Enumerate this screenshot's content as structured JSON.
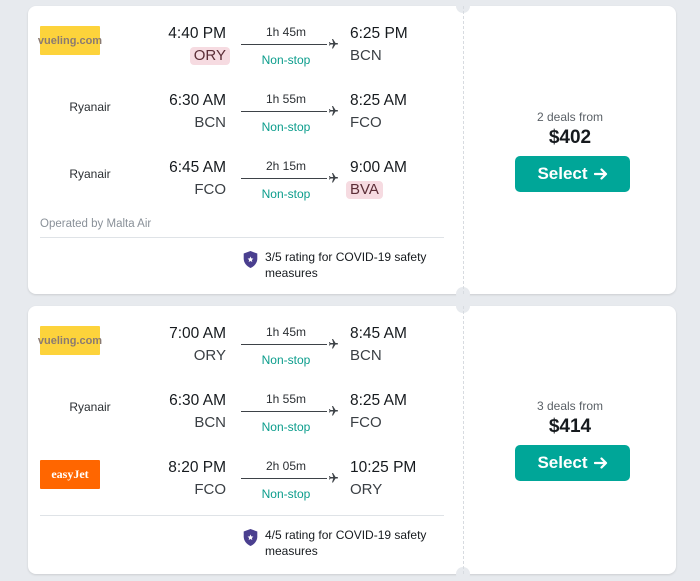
{
  "results": [
    {
      "legs": [
        {
          "airline": "vueling.com",
          "logo": "vueling",
          "dep_time": "4:40 PM",
          "dep_code": "ORY",
          "dep_highlight": true,
          "duration": "1h 45m",
          "stops": "Non-stop",
          "arr_time": "6:25 PM",
          "arr_code": "BCN",
          "arr_highlight": false
        },
        {
          "airline": "Ryanair",
          "logo": "",
          "dep_time": "6:30 AM",
          "dep_code": "BCN",
          "dep_highlight": false,
          "duration": "1h 55m",
          "stops": "Non-stop",
          "arr_time": "8:25 AM",
          "arr_code": "FCO",
          "arr_highlight": false
        },
        {
          "airline": "Ryanair",
          "logo": "",
          "dep_time": "6:45 AM",
          "dep_code": "FCO",
          "dep_highlight": false,
          "duration": "2h 15m",
          "stops": "Non-stop",
          "arr_time": "9:00 AM",
          "arr_code": "BVA",
          "arr_highlight": true
        }
      ],
      "operated_by": "Operated by Malta Air",
      "covid_rating": "3/5 rating for COVID-19 safety measures",
      "deals": "2 deals from",
      "price": "$402",
      "select_label": "Select"
    },
    {
      "legs": [
        {
          "airline": "vueling.com",
          "logo": "vueling",
          "dep_time": "7:00 AM",
          "dep_code": "ORY",
          "dep_highlight": false,
          "duration": "1h 45m",
          "stops": "Non-stop",
          "arr_time": "8:45 AM",
          "arr_code": "BCN",
          "arr_highlight": false
        },
        {
          "airline": "Ryanair",
          "logo": "",
          "dep_time": "6:30 AM",
          "dep_code": "BCN",
          "dep_highlight": false,
          "duration": "1h 55m",
          "stops": "Non-stop",
          "arr_time": "8:25 AM",
          "arr_code": "FCO",
          "arr_highlight": false
        },
        {
          "airline": "easyJet",
          "logo": "easyjet",
          "dep_time": "8:20 PM",
          "dep_code": "FCO",
          "dep_highlight": false,
          "duration": "2h 05m",
          "stops": "Non-stop",
          "arr_time": "10:25 PM",
          "arr_code": "ORY",
          "arr_highlight": false
        }
      ],
      "operated_by": "",
      "covid_rating": "4/5 rating for COVID-19 safety measures",
      "deals": "3 deals from",
      "price": "$414",
      "select_label": "Select"
    }
  ],
  "colors": {
    "accent": "#00a698",
    "nonstop": "#0b9d8c",
    "airport_highlight": "#f6dbe1",
    "vueling_logo": "#fdd33b",
    "easyjet_logo": "#ff6600"
  },
  "icons": {
    "plane": "plane-icon",
    "shield": "shield-icon",
    "arrow": "arrow-right-icon"
  }
}
